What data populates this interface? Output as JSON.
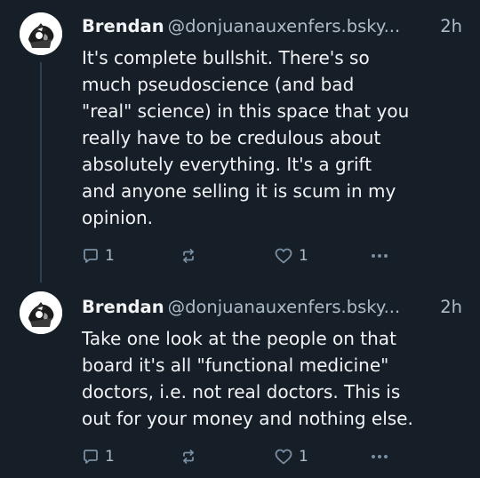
{
  "posts": [
    {
      "author": "Brendan",
      "handle": "@donjuanauxenfers.bsky...",
      "time": "2h",
      "lines": [
        "It's complete bullshit. There's so",
        "much pseudoscience (and bad",
        "\"real\" science) in this space that you",
        "really have to be credulous about",
        "absolutely everything. It's a grift",
        "and anyone selling it is scum in my",
        "opinion."
      ],
      "reply_count": "1",
      "like_count": "1",
      "icons": [
        "avatar",
        "reply-icon",
        "repost-icon",
        "like-icon",
        "more-icon"
      ]
    },
    {
      "author": "Brendan",
      "handle": "@donjuanauxenfers.bsky...",
      "time": "2h",
      "lines": [
        "Take one look at the people on that",
        "board it's all \"functional medicine\"",
        "doctors, i.e. not real doctors. This is",
        "out for your money and nothing else."
      ],
      "reply_count": "1",
      "like_count": "1",
      "icons": [
        "avatar",
        "reply-icon",
        "repost-icon",
        "like-icon",
        "more-icon"
      ]
    }
  ],
  "colors": {
    "background": "#161e27",
    "text": "#f1f3f5",
    "muted": "#aebbc9",
    "icon": "#7a8da1",
    "thread_line": "#2e4052"
  }
}
